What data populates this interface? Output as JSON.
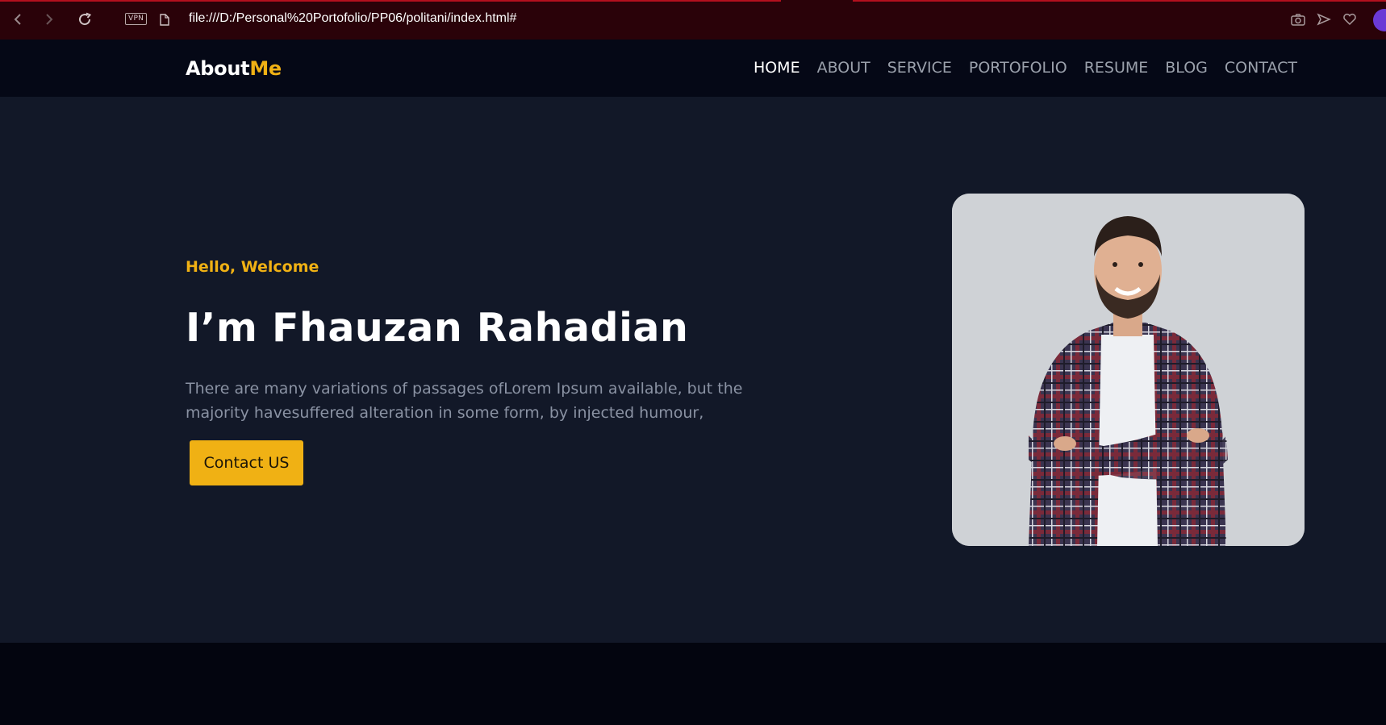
{
  "browser": {
    "vpn_label": "VPN",
    "url": "file:///D:/Personal%20Portofolio/PP06/politani/index.html#"
  },
  "site": {
    "logo_main": "About",
    "logo_accent": "Me",
    "nav": [
      {
        "label": "HOME",
        "active": true
      },
      {
        "label": "ABOUT"
      },
      {
        "label": "SERVICE"
      },
      {
        "label": "PORTOFOLIO"
      },
      {
        "label": "RESUME"
      },
      {
        "label": "BLOG"
      },
      {
        "label": "CONTACT"
      }
    ]
  },
  "hero": {
    "greeting": "Hello, Welcome",
    "title": "I’m Fhauzan Rahadian",
    "description": "There are many variations of passages ofLorem Ipsum available, but the majority havesuffered alteration in some form, by injected humour,",
    "cta_label": "Contact US"
  },
  "colors": {
    "accent": "#f0b114",
    "header_bg": "#050816",
    "hero_bg": "#121828",
    "browser_bg": "#2a0209"
  },
  "icons": [
    "back-arrow-icon",
    "forward-arrow-icon",
    "reload-icon",
    "page-icon",
    "camera-icon",
    "send-icon",
    "heart-icon"
  ]
}
